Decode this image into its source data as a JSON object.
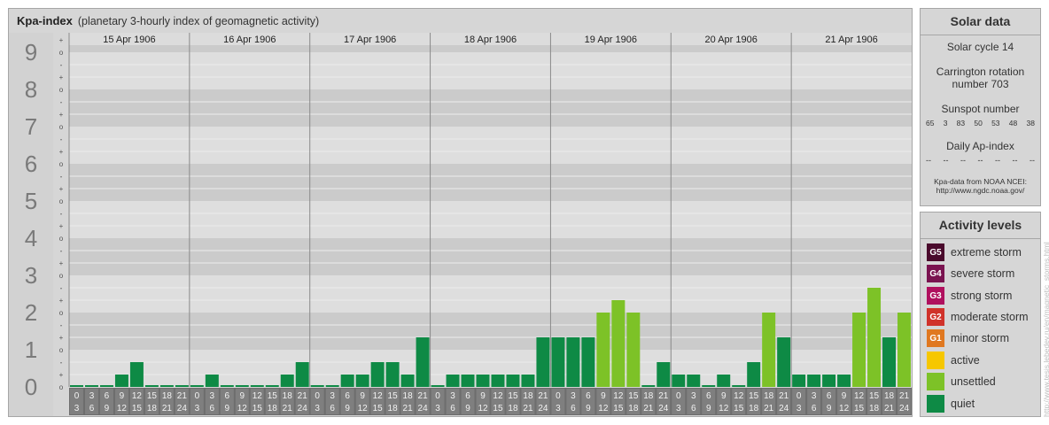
{
  "header": {
    "title": "Kpa-index",
    "subtitle": "(planetary 3-hourly index of geomagnetic activity)"
  },
  "chart_data": {
    "type": "bar",
    "title": "Kpa-index",
    "subtitle": "(planetary 3-hourly index of geomagnetic activity)",
    "ylim": [
      0,
      9
    ],
    "y_major_ticks": [
      "0",
      "1",
      "2",
      "3",
      "4",
      "5",
      "6",
      "7",
      "8",
      "9"
    ],
    "y_minor_ticks": [
      "o",
      "+",
      "-"
    ],
    "days": [
      "15 Apr 1906",
      "16 Apr 1906",
      "17 Apr 1906",
      "18 Apr 1906",
      "19 Apr 1906",
      "20 Apr 1906",
      "21 Apr 1906"
    ],
    "interval_start_hours": [
      "0",
      "3",
      "6",
      "9",
      "12",
      "15",
      "18",
      "21"
    ],
    "interval_end_hours": [
      "3",
      "6",
      "9",
      "12",
      "15",
      "18",
      "21",
      "24"
    ],
    "values": [
      [
        0,
        0,
        0,
        0.333,
        0.667,
        0,
        0,
        0
      ],
      [
        0,
        0.333,
        0,
        0,
        0,
        0,
        0.333,
        0.667
      ],
      [
        0,
        0,
        0.333,
        0.333,
        0.667,
        0.667,
        0.333,
        1.333
      ],
      [
        0,
        0.333,
        0.333,
        0.333,
        0.333,
        0.333,
        0.333,
        1.333
      ],
      [
        1.333,
        1.333,
        1.333,
        2,
        2.333,
        2,
        0,
        0.667
      ],
      [
        0.333,
        0.333,
        0,
        0.333,
        0,
        0.667,
        2,
        1.333
      ],
      [
        0.333,
        0.333,
        0.333,
        0.333,
        2,
        2.667,
        1.333,
        2
      ]
    ],
    "grid": true,
    "legend": "right-panel"
  },
  "solar": {
    "title": "Solar data",
    "cycle": "Solar cycle 14",
    "carrington_line1": "Carrington rotation",
    "carrington_line2": "number 703",
    "sunspot_title": "Sunspot number",
    "sunspot_values": [
      "65",
      "3",
      "83",
      "50",
      "53",
      "48",
      "38"
    ],
    "ap_title": "Daily Ap-index",
    "ap_values": [
      "--",
      "--",
      "--",
      "--",
      "--",
      "--",
      "--"
    ],
    "source_line1": "Kpa-data from NOAA NCEI:",
    "source_line2": "http://www.ngdc.noaa.gov/"
  },
  "activity": {
    "title": "Activity levels",
    "levels": [
      {
        "badge": "G5",
        "label": "extreme storm",
        "color": "#4a0a2c"
      },
      {
        "badge": "G4",
        "label": "severe storm",
        "color": "#7a1350"
      },
      {
        "badge": "G3",
        "label": "strong storm",
        "color": "#b0105e"
      },
      {
        "badge": "G2",
        "label": "moderate storm",
        "color": "#d0322a"
      },
      {
        "badge": "G1",
        "label": "minor storm",
        "color": "#e07820"
      },
      {
        "badge": "",
        "label": "active",
        "color": "#f6c700"
      },
      {
        "badge": "",
        "label": "unsettled",
        "color": "#7dc227"
      },
      {
        "badge": "",
        "label": "quiet",
        "color": "#0e8a45"
      }
    ]
  },
  "credit": "http://www.tesis.lebedev.ru/en/magnetic_storms.html"
}
